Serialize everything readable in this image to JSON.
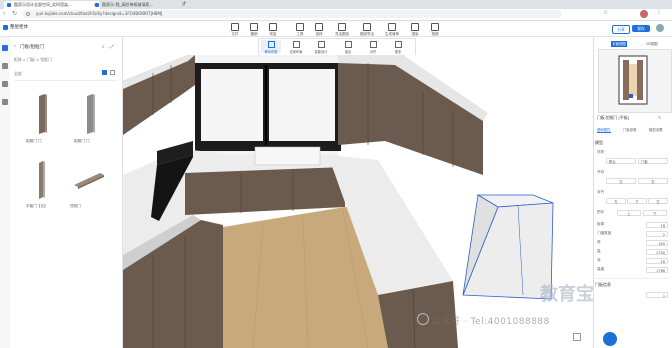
{
  "browser": {
    "tabs": [
      {
        "label": "酷家乐设计全部空间_实时渲染..."
      },
      {
        "label": "酷家乐-我_高阶带框玻璃柜..."
      }
    ],
    "url": "yun.kujiale.com/cloud/tool/h5/diy?designid=3FO4BOIBOTJHBMJ"
  },
  "app": {
    "design_name": "整屋柜体",
    "toolbar": [
      "文件",
      "撤销",
      "恢复",
      "工具",
      "选择",
      "灵活图纸",
      "图纸导出",
      "生成清单",
      "渲染",
      "视频"
    ],
    "sub_toolbar": [
      "移动布置",
      "空间布局",
      "智能设计",
      "组合",
      "对齐",
      "更多"
    ],
    "right_buttons": [
      "分享",
      "保存"
    ]
  },
  "left_panel": {
    "breadcrumb": "门板/铝框门",
    "path": "柜体 > 门板 > 铝框门",
    "filter_label": "全部",
    "section_label": "默认",
    "items": [
      {
        "label": "铝框门 门"
      },
      {
        "label": "铝框门 门"
      },
      {
        "label": "平板门【无】"
      },
      {
        "label": "顶线门"
      }
    ]
  },
  "right_panel": {
    "tabs": [
      "平面视图",
      "2D视图"
    ],
    "title": "门板-铝框门 [平板]",
    "sub_tabs": [
      "基础属性",
      "门板参数",
      "模型设置"
    ],
    "section": "模型",
    "rows": [
      {
        "label": "材质",
        "values": [
          "默认",
          "门板"
        ]
      },
      {
        "label": "开向",
        "values": [
          "左",
          "右"
        ]
      },
      {
        "label": "对齐",
        "values": [
          "左",
          "下",
          "左"
        ]
      },
      {
        "label": "把手",
        "values": [
          "上",
          "下"
        ]
      },
      {
        "label": "板厚",
        "values": [
          "18"
        ]
      },
      {
        "label": "门缝宽度",
        "values": [
          "2"
        ]
      },
      {
        "label": "宽",
        "values": [
          "450"
        ]
      },
      {
        "label": "高",
        "values": [
          "2700"
        ]
      },
      {
        "label": "深",
        "values": [
          "18"
        ]
      },
      {
        "label": "高度",
        "values": [
          "1786"
        ]
      }
    ],
    "bottom_section": "门板信息",
    "bottom_value": "1"
  },
  "watermark": {
    "channel": "公众号 · Tel:4001088888",
    "brand": "教育宝"
  },
  "colors": {
    "accent": "#1e6fd9",
    "wood_dark": "#6b5a4e",
    "wood_floor": "#c8a97b",
    "counter": "#e9e9e9"
  }
}
